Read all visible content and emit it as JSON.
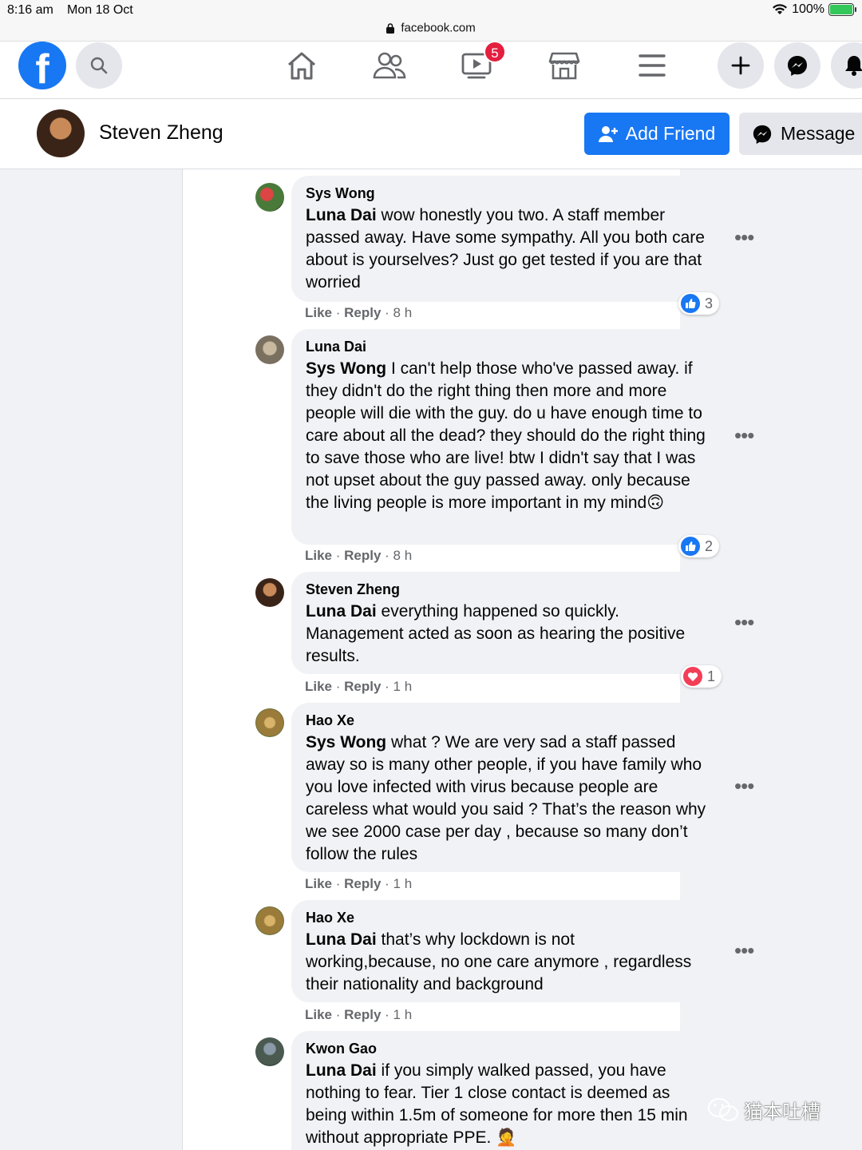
{
  "status": {
    "time": "8:16 am",
    "date": "Mon 18 Oct",
    "battery": "100%"
  },
  "browser": {
    "url": "facebook.com"
  },
  "nav": {
    "watch_badge": "5"
  },
  "profile": {
    "name": "Steven Zheng",
    "add_friend": "Add Friend",
    "message": "Message"
  },
  "colors": {
    "brand": "#1877f2",
    "badge": "#e41e3f",
    "bubble": "#f0f2f5",
    "secondary_text": "#65676b",
    "love": "#f33e58"
  },
  "comments": [
    {
      "author": "Sys Wong",
      "mention": "Luna Dai",
      "text": " wow honestly you two. A staff member passed away. Have some sympathy. All you both care about is yourselves? Just go get tested if you are that worried",
      "like": "Like",
      "reply": "Reply",
      "time": "8 h",
      "reaction_count": "3",
      "reaction_type": "like"
    },
    {
      "author": "Luna Dai",
      "mention": "Sys Wong",
      "text": " I can't help those who've passed away. if they didn't do the right thing then more and more people will die with the guy. do u have enough time to care about all the dead? they should do the right thing to save those who are live! btw I didn't say that I was not upset about the guy passed away. only because the living people is more important in my mind🙃",
      "like": "Like",
      "reply": "Reply",
      "time": "8 h",
      "reaction_count": "2",
      "reaction_type": "like"
    },
    {
      "author": "Steven Zheng",
      "mention": "Luna Dai",
      "text": " everything happened so quickly. Management acted as soon as hearing the positive results.",
      "like": "Like",
      "reply": "Reply",
      "time": "1 h",
      "reaction_count": "1",
      "reaction_type": "love"
    },
    {
      "author": "Hao Xe",
      "mention": "Sys Wong",
      "text": " what ? We are very sad a staff passed away so is many other people, if you have family who you love infected with virus because people are careless what would you said ? That’s the reason why we see 2000 case per day , because so many don’t follow the rules",
      "like": "Like",
      "reply": "Reply",
      "time": "1 h"
    },
    {
      "author": "Hao Xe",
      "mention": "Luna Dai",
      "text": " that’s why lockdown is not working,because, no one care anymore , regardless their nationality and background",
      "like": "Like",
      "reply": "Reply",
      "time": "1 h"
    },
    {
      "author": "Kwon Gao",
      "mention": "Luna Dai",
      "text": " if you simply walked passed, you have nothing to fear. Tier 1 close contact is deemed as being within 1.5m of someone for more then 15 min without appropriate PPE. 🤦"
    }
  ],
  "watermark": "猫本吐槽",
  "icons": [
    "wifi-icon",
    "battery-icon",
    "lock-icon",
    "search-icon",
    "home-icon",
    "friends-icon",
    "watch-icon",
    "marketplace-icon",
    "menu-icon",
    "plus-icon",
    "messenger-icon",
    "bell-icon",
    "add-friend-icon",
    "more-options-icon",
    "like-reaction-icon",
    "love-reaction-icon",
    "wechat-icon"
  ]
}
